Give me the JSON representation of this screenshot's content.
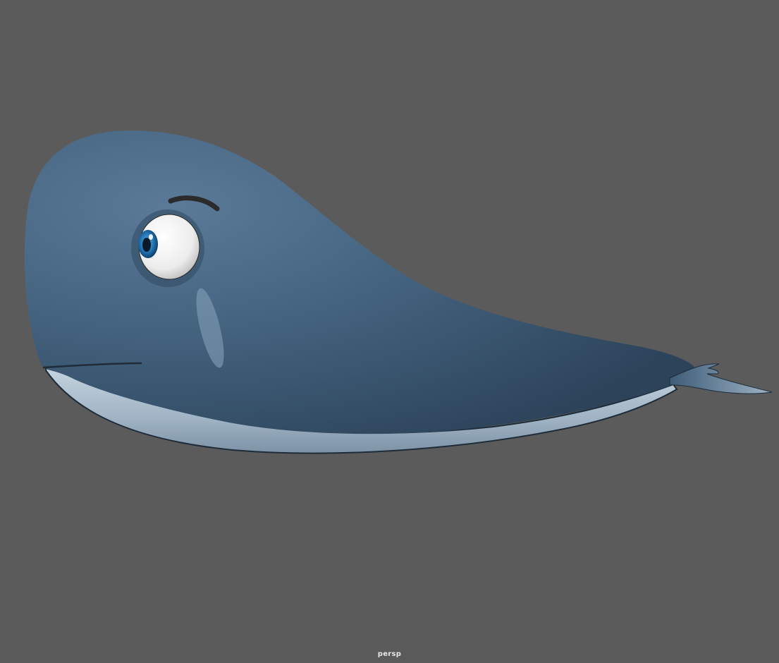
{
  "viewport": {
    "camera_name": "persp",
    "background_color": "#5b5b5b"
  },
  "model": {
    "subject": "whale",
    "body_color": "#3e5c78",
    "belly_color": "#a9bccb",
    "eye_iris_color": "#1f6fae"
  }
}
